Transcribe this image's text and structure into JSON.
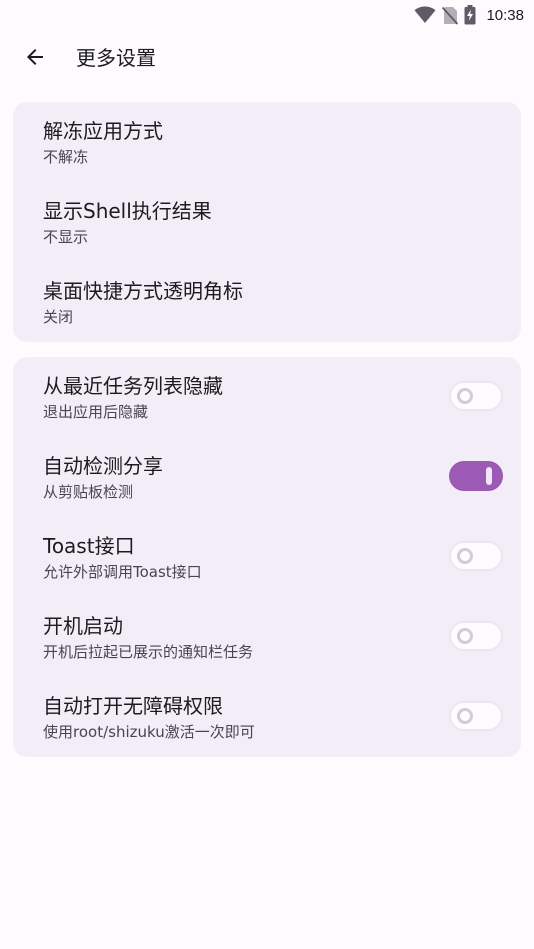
{
  "status_bar": {
    "time": "10:38",
    "icons": [
      "wifi-icon",
      "no-sim-icon",
      "battery-charging-icon"
    ]
  },
  "app_bar": {
    "back_icon": "arrow-back-icon",
    "title": "更多设置"
  },
  "settings_group_1": {
    "items": [
      {
        "title": "解冻应用方式",
        "subtitle": "不解冻"
      },
      {
        "title": "显示Shell执行结果",
        "subtitle": "不显示"
      },
      {
        "title": "桌面快捷方式透明角标",
        "subtitle": "关闭"
      }
    ]
  },
  "settings_group_2": {
    "items": [
      {
        "title": "从最近任务列表隐藏",
        "subtitle": "退出应用后隐藏",
        "enabled": false
      },
      {
        "title": "自动检测分享",
        "subtitle": "从剪贴板检测",
        "enabled": true
      },
      {
        "title": "Toast接口",
        "subtitle": "允许外部调用Toast接口",
        "enabled": false
      },
      {
        "title": "开机启动",
        "subtitle": "开机后拉起已展示的通知栏任务",
        "enabled": false
      },
      {
        "title": "自动打开无障碍权限",
        "subtitle": "使用root/shizuku激活一次即可",
        "enabled": false
      }
    ]
  },
  "colors": {
    "background": "#fefbff",
    "card": "#f3edf7",
    "switch_on": "#9b5ab3",
    "text_primary": "#1c1b1f",
    "text_secondary": "#49454f"
  }
}
